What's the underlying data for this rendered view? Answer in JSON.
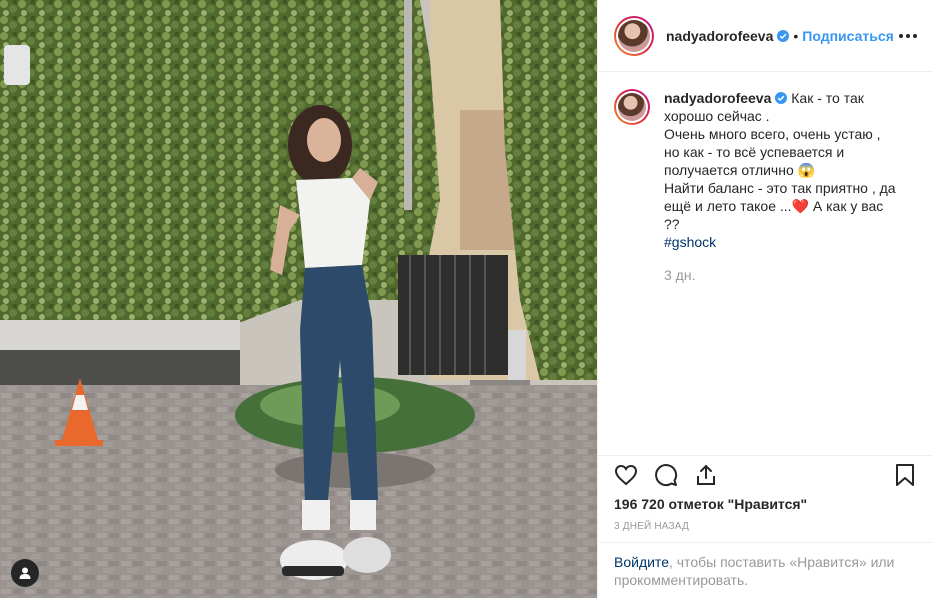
{
  "post": {
    "username": "nadyadorofeeva",
    "follow_label": "Подписаться",
    "separator": "•",
    "caption_parts": [
      "Как - то так хорошо сейчас .",
      "Очень много всего, очень устаю , но как - то всё успевается и получается отлично 😱",
      "Найти баланс - это так приятно , да ещё и лето такое ...❤️ А как у вас ??"
    ],
    "hashtag": "#gshock",
    "relative_time": "3 дн.",
    "likes_text": "196 720 отметок \"Нравится\"",
    "timestamp": "3 дней назад",
    "login_link": "Войдите",
    "login_rest": ", чтобы поставить «Нравится» или прокомментировать."
  },
  "icons": {
    "like": "heart-icon",
    "comment": "comment-icon",
    "share": "share-icon",
    "save": "bookmark-icon",
    "more": "more-icon",
    "user_tag": "user-icon",
    "verified": "verified-badge-icon"
  },
  "colors": {
    "link": "#3897f0",
    "hashtag": "#003569",
    "muted": "#999999",
    "text": "#262626"
  }
}
